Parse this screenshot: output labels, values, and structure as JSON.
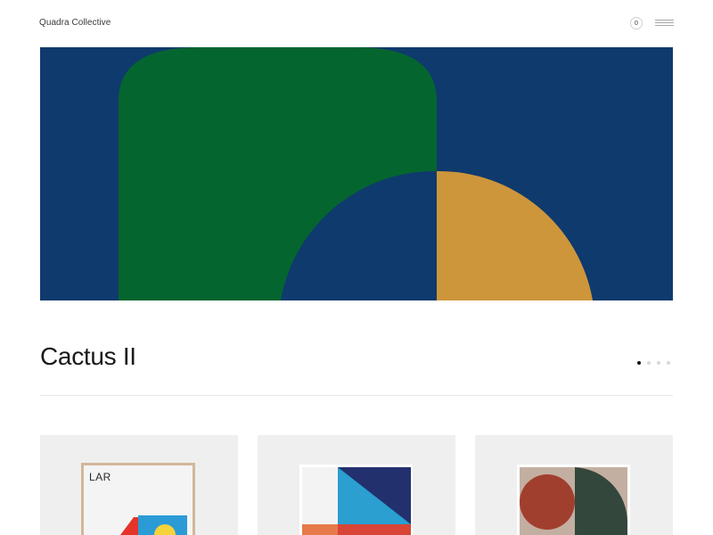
{
  "header": {
    "brand": "Quadra Collective",
    "cart_count": "0",
    "menu_icon": "hamburger-menu-icon"
  },
  "hero": {
    "artwork": "abstract geometric print",
    "colors": {
      "background": "#0f3a6d",
      "arch": "#05652f",
      "semicircle_left": "#0f3a6d",
      "semicircle_right": "#cd963b"
    }
  },
  "product": {
    "title": "Cactus II",
    "carousel_total": 4,
    "carousel_active": 1
  },
  "cards": [
    {
      "label": "LAR"
    },
    {
      "label": ""
    },
    {
      "label": ""
    }
  ]
}
